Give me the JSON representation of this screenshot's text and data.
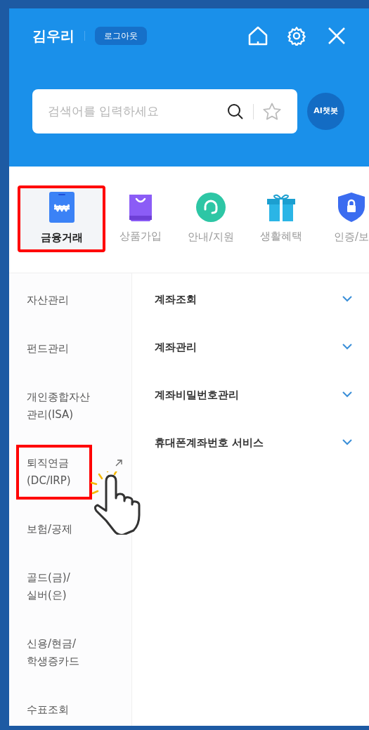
{
  "header": {
    "user_name": "김우리",
    "logout": "로그아웃",
    "search": {
      "placeholder": "검색어를 입력하세요"
    },
    "chatbot": "AI챗봇"
  },
  "categories": [
    {
      "label": "금융거래",
      "kind": "wallet",
      "selected": true
    },
    {
      "label": "상품가입",
      "kind": "bag",
      "selected": false
    },
    {
      "label": "안내/지원",
      "kind": "headset",
      "selected": false
    },
    {
      "label": "생활혜택",
      "kind": "gift",
      "selected": false
    },
    {
      "label": "인증/보",
      "kind": "shield",
      "selected": false
    }
  ],
  "menu": [
    {
      "label": "자산관리",
      "external": false,
      "highlighted": false
    },
    {
      "label": "펀드관리",
      "external": false,
      "highlighted": false
    },
    {
      "label": "개인종합자산\n관리(ISA)",
      "external": false,
      "highlighted": false
    },
    {
      "label": "퇴직연금\n(DC/IRP)",
      "external": true,
      "highlighted": true
    },
    {
      "label": "보험/공제",
      "external": false,
      "highlighted": false
    },
    {
      "label": "골드(금)/\n실버(은)",
      "external": false,
      "highlighted": false
    },
    {
      "label": "신용/현금/\n학생증카드",
      "external": false,
      "highlighted": false
    },
    {
      "label": "수표조회",
      "external": false,
      "highlighted": false
    }
  ],
  "submenu": [
    {
      "label": "계좌조회",
      "expanded": false
    },
    {
      "label": "계좌관리",
      "expanded": false
    },
    {
      "label": "계좌비밀번호관리",
      "expanded": false
    },
    {
      "label": "휴대폰계좌번호 서비스",
      "expanded": false
    }
  ]
}
